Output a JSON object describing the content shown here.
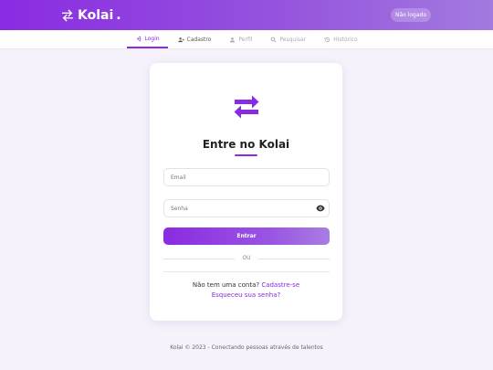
{
  "header": {
    "brand": "Kolai",
    "brand_dot": ".",
    "status_badge": "Não logado"
  },
  "nav": {
    "items": [
      {
        "label": "Login",
        "icon": "login-icon",
        "state": "active"
      },
      {
        "label": "Cadastro",
        "icon": "user-plus-icon",
        "state": "normal"
      },
      {
        "label": "Perfil",
        "icon": "user-icon",
        "state": "disabled"
      },
      {
        "label": "Pesquisar",
        "icon": "search-icon",
        "state": "disabled"
      },
      {
        "label": "Histórico",
        "icon": "history-icon",
        "state": "disabled"
      }
    ]
  },
  "login": {
    "title": "Entre no Kolai",
    "email_placeholder": "Email",
    "password_placeholder": "Senha",
    "submit_label": "Entrar",
    "divider_text": "OU",
    "no_account_text": "Não tem uma conta?",
    "signup_link": "Cadastre-se",
    "forgot_link": "Esqueceu sua senha?"
  },
  "footer": {
    "text": "Kolai © 2023 - Conectando pessoas através de talentos"
  },
  "colors": {
    "accent": "#8a2be2",
    "background": "#f6f2fb"
  }
}
